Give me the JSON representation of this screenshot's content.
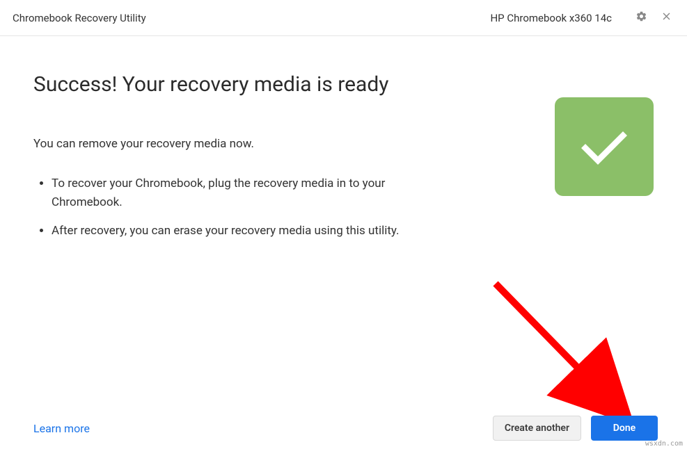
{
  "header": {
    "title": "Chromebook Recovery Utility",
    "device": "HP Chromebook x360 14c"
  },
  "main": {
    "title": "Success! Your recovery media is ready",
    "subtitle": "You can remove your recovery media now.",
    "instructions": [
      "To recover your Chromebook, plug the recovery media in to your Chromebook.",
      "After recovery, you can erase your recovery media using this utility."
    ]
  },
  "footer": {
    "learn_more": "Learn more",
    "create_another": "Create another",
    "done": "Done"
  },
  "attribution": "wsxdn.com"
}
